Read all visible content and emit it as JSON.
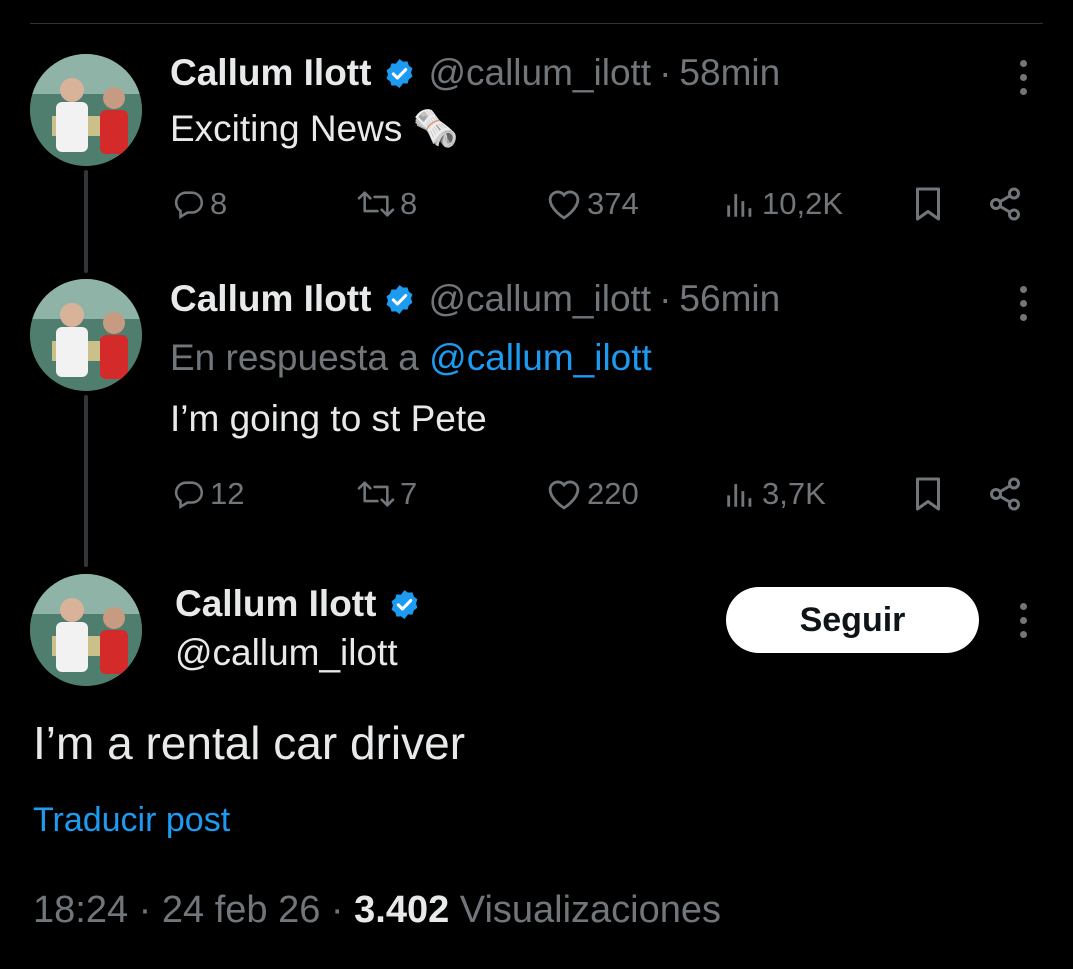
{
  "colors": {
    "accent": "#1d9bf0",
    "background": "#000000",
    "muted": "#71767b",
    "text": "#e7e9ea"
  },
  "tweets": [
    {
      "name": "Callum Ilott",
      "handle": "@callum_ilott",
      "time": "58min",
      "text": "Exciting News 🗞️",
      "replies": "8",
      "reposts": "8",
      "likes": "374",
      "views": "10,2K"
    },
    {
      "name": "Callum Ilott",
      "handle": "@callum_ilott",
      "time": "56min",
      "reply_prefix": "En respuesta a",
      "reply_mention": "@callum_ilott",
      "text": "I’m going to st Pete",
      "replies": "12",
      "reposts": "7",
      "likes": "220",
      "views": "3,7K"
    }
  ],
  "main": {
    "name": "Callum Ilott",
    "handle": "@callum_ilott",
    "follow_label": "Seguir",
    "text": "I’m a rental car driver",
    "translate_label": "Traducir post",
    "timestamp": "18:24 · 24 feb 26",
    "separator": "·",
    "views_count": "3.402",
    "views_label": "Visualizaciones"
  }
}
